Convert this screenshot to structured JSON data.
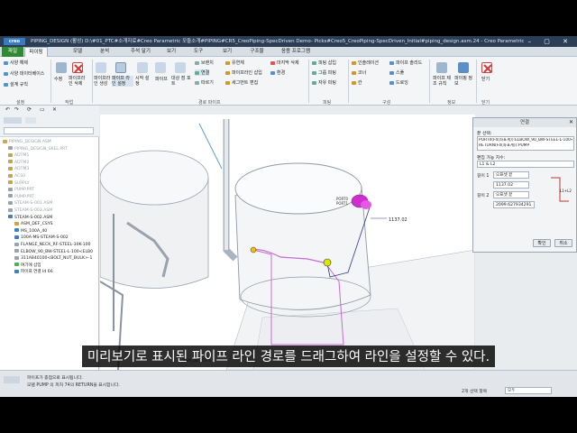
{
  "titlebar": {
    "logo": "creo",
    "title": "PIPING_DESIGN (활성) D:\\#01_PTC#소개자료#Creo Parametric 모듈소개#PIPING#CR5_CreoPiping-SpecDriven Demo- Picks#Creo5_CreoPiping-SpecDriven_Initial#piping_design.asm.24 - Creo Parametric"
  },
  "tabs": [
    {
      "label": "파일"
    },
    {
      "label": "파이핑"
    },
    {
      "label": "모델"
    },
    {
      "label": "분석"
    },
    {
      "label": "주석 달기"
    },
    {
      "label": "보기"
    },
    {
      "label": "도구"
    },
    {
      "label": "보기"
    },
    {
      "label": "구조물"
    },
    {
      "label": "응용 프로그램"
    }
  ],
  "ribbon": {
    "left_items": [
      "사양 해제",
      "사양 데이터베이스",
      "설계 규칙"
    ],
    "btn_insert": "수정",
    "btn_delete": "파이프라인 삭제",
    "btn_route": "파이프라인 생성",
    "btn_line": "파이프 라인 설정",
    "btn_start": "시작 설정",
    "btn_pipe": "파이프",
    "btn_straight": "대상 점 포트",
    "route_items": [
      "브랜치",
      "연결",
      "따르기"
    ],
    "route_items2": [
      "유연체",
      "파이프라인 삽입",
      "세그먼트 편집"
    ],
    "route_items3": [
      "마지막 삭제",
      "환경"
    ],
    "fitting_items": [
      "피팅 삽입",
      "그룹 피팅",
      "자유 피팅"
    ],
    "struct_items": [
      "인솔레이션",
      "코너",
      "칸"
    ],
    "struct_items2": [
      "파이프 솔리드",
      "스풀",
      "드로잉"
    ],
    "info_items": [
      "파이프 제조 규칙",
      "파이핑 정보"
    ],
    "close": "닫기",
    "group_labels": [
      "설정",
      "작업",
      "경로 파이프",
      "피팅",
      "구성",
      "정보",
      "닫기"
    ]
  },
  "tree": {
    "search_placeholder": "",
    "rows": [
      {
        "label": "PIPING_DESIGN.ASM",
        "color": "#d9a441",
        "dim": true
      },
      {
        "label": "PIPING_DESIGN_SKEL.PRT",
        "color": "#9aa3ad",
        "dim": true
      },
      {
        "label": "ADTM1",
        "color": "#c7a34b",
        "dim": true
      },
      {
        "label": "ADTM2",
        "color": "#c7a34b",
        "dim": true
      },
      {
        "label": "ADTM3",
        "color": "#c7a34b",
        "dim": true
      },
      {
        "label": "ACS0",
        "color": "#c7a34b",
        "dim": true
      },
      {
        "label": "SUPPLY",
        "color": "#c7a34b",
        "dim": true
      },
      {
        "label": "PUMP.PRT",
        "color": "#9aa3ad",
        "dim": true
      },
      {
        "label": "PUMP.PRT",
        "color": "#9aa3ad",
        "dim": true
      },
      {
        "label": "STEAM-S-001.ASM",
        "color": "#9aa3ad",
        "dim": true
      },
      {
        "label": "STEAM-S-003.ASM",
        "color": "#9aa3ad",
        "dim": true
      },
      {
        "label": "STEAM-S-002.ASM",
        "color": "#3f7fbf",
        "dim": false
      },
      {
        "label": "ASM_DEF_CSYS",
        "color": "#c7a34b",
        "dim": false
      },
      {
        "label": "MS_100A_40",
        "color": "#3f7fbf",
        "dim": false
      },
      {
        "label": "100A-MS-STEAM-S-002",
        "color": "#3f7fbf",
        "dim": false
      },
      {
        "label": "FLANGE_NECK_RF-STEEL-30K-100",
        "color": "#9aa3ad",
        "dim": false
      },
      {
        "label": "ELBOW_90_BW-STEEL-L-100<ELB0",
        "color": "#9aa3ad",
        "dim": false
      },
      {
        "label": "311A840100<BOLT_NUT_BULK>-1",
        "color": "#9aa3ad",
        "dim": false
      },
      {
        "label": "여기에 삽입",
        "color": "#4caf50",
        "dim": false
      },
      {
        "label": "파이프 연결 Id 66",
        "color": "#3f7fbf",
        "dim": false
      }
    ]
  },
  "canvas": {
    "dim_label": "1137.02",
    "port_labels": [
      "PORT0",
      "PORT1"
    ],
    "asm_label": "ASM_DEF_CSYS"
  },
  "dialog": {
    "title": "연결",
    "ref_label": "끝 선택:",
    "ref_value": "PORT0(F4(좌표계)):ELBOW_90_BW-STEEL-L-100<ELB0>",
    "ref_value2": "RETURN(F4(좌표계)):PUMP",
    "editable_label": "편집 가능 치수:",
    "editable_value": "L1 & L2",
    "len1_label": "길이 1",
    "len1_mode": "오프셋 끝",
    "len1_value": "1137.02",
    "len2_label": "길이 2",
    "len2_mode": "오프셋 끝",
    "len2_value": "2099.627934291",
    "diagram_label": "L1+L2",
    "ok": "확인",
    "cancel": "취소"
  },
  "status": {
    "line1": "파이프가 종점으로 표시됩니다.",
    "line2": "모델 PUMP 의 피처 74의 RETURN을 표시합니다.",
    "selection_count": "2개 선택 항목",
    "filter": "모두"
  },
  "subtitle": "미리보기로 표시된 파이프 라인 경로를 드래그하여 라인을 설정할 수 있다."
}
